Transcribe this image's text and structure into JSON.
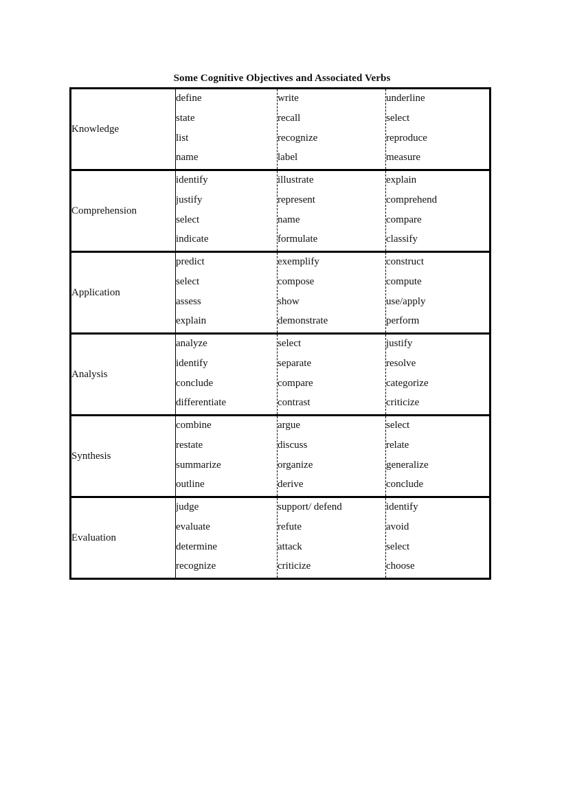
{
  "document": {
    "title": "Some Cognitive Objectives and Associated Verbs",
    "groups": [
      {
        "category": "Knowledge",
        "columns": [
          [
            "define",
            "state",
            "list",
            "name"
          ],
          [
            "write",
            "recall",
            "recognize",
            "label"
          ],
          [
            "underline",
            "select",
            "reproduce",
            "measure"
          ]
        ]
      },
      {
        "category": "Comprehension",
        "columns": [
          [
            "identify",
            "justify",
            "select",
            "indicate"
          ],
          [
            "illustrate",
            "represent",
            "name",
            "formulate"
          ],
          [
            "explain",
            "comprehend",
            "compare",
            "classify"
          ]
        ]
      },
      {
        "category": "Application",
        "columns": [
          [
            "predict",
            "select",
            "assess",
            "explain"
          ],
          [
            "exemplify",
            "compose",
            "show",
            "demonstrate"
          ],
          [
            "construct",
            "compute",
            "use/apply",
            "perform"
          ]
        ]
      },
      {
        "category": "Analysis",
        "columns": [
          [
            "analyze",
            "identify",
            "conclude",
            "differentiate"
          ],
          [
            "select",
            "separate",
            "compare",
            "contrast"
          ],
          [
            "justify",
            "resolve",
            "categorize",
            "criticize"
          ]
        ]
      },
      {
        "category": "Synthesis",
        "columns": [
          [
            "combine",
            "restate",
            "summarize",
            "outline"
          ],
          [
            "argue",
            "discuss",
            "organize",
            "derive"
          ],
          [
            "select",
            "relate",
            "generalize",
            "conclude"
          ]
        ]
      },
      {
        "category": "Evaluation",
        "columns": [
          [
            "judge",
            "evaluate",
            "determine",
            "recognize"
          ],
          [
            "support/ defend",
            "refute",
            "attack",
            "criticize"
          ],
          [
            "identify",
            "avoid",
            "select",
            "choose"
          ]
        ]
      }
    ]
  }
}
